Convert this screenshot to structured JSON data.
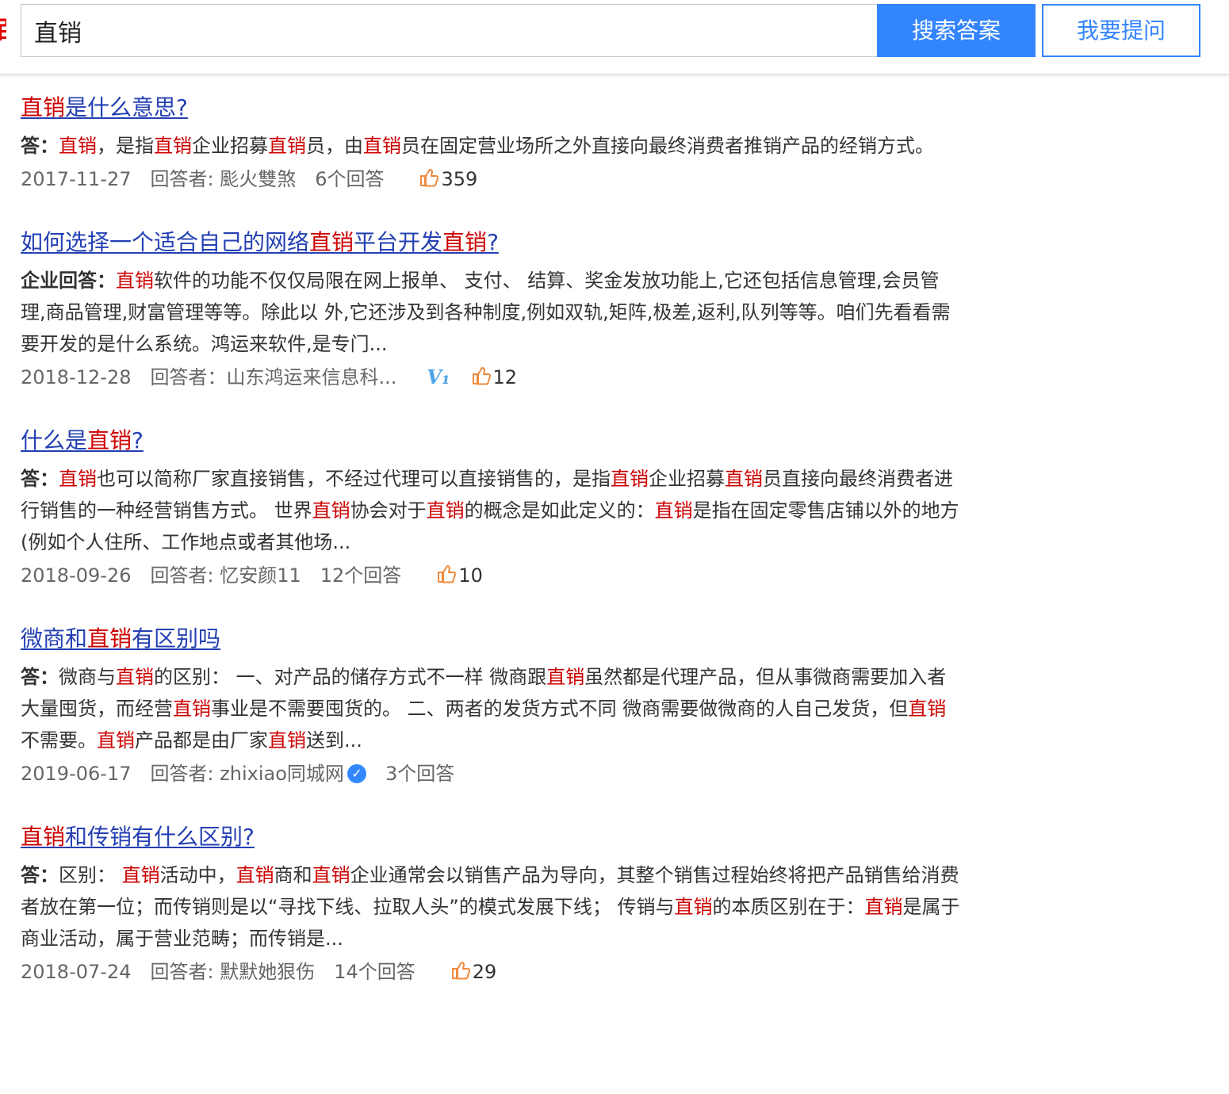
{
  "header": {
    "logo_fragment": "百",
    "search_value": "直销",
    "search_button": "搜索答案",
    "ask_button": "我要提问"
  },
  "results": [
    {
      "title": [
        {
          "t": "直销",
          "h": true
        },
        {
          "t": "是什么意思? ",
          "h": false
        }
      ],
      "prefix": "答：",
      "abstract": [
        {
          "t": "直销",
          "h": true
        },
        {
          "t": "，是指",
          "h": false
        },
        {
          "t": "直销",
          "h": true
        },
        {
          "t": "企业招募",
          "h": false
        },
        {
          "t": "直销",
          "h": true
        },
        {
          "t": "员，由",
          "h": false
        },
        {
          "t": "直销",
          "h": true
        },
        {
          "t": "员在固定营业场所之外直接向最终消费者推销产品的经销方式。",
          "h": false
        }
      ],
      "meta": {
        "date": "2017-11-27",
        "answerer": "回答者: 颩火雙煞",
        "count": "6个回答",
        "likes": "359",
        "badge": ""
      }
    },
    {
      "title": [
        {
          "t": "如何选择一个适合自己的网络",
          "h": false
        },
        {
          "t": "直销",
          "h": true
        },
        {
          "t": "平台开发",
          "h": false
        },
        {
          "t": "直销",
          "h": true
        },
        {
          "t": "?",
          "h": false
        }
      ],
      "prefix": "企业回答：",
      "abstract": [
        {
          "t": "直销",
          "h": true
        },
        {
          "t": "软件的功能不仅仅局限在网上报单、 支付、 结算、奖金发放功能上,它还包括信息管理,会员管理,商品管理,财富管理等等。除此以 外,它还涉及到各种制度,例如双轨,矩阵,极差,返利,队列等等。咱们先看看需要开发的是什么系统。鸿运来软件,是专门...",
          "h": false
        }
      ],
      "meta": {
        "date": "2018-12-28",
        "answerer": "回答者：山东鸿运来信息科...",
        "count": "",
        "likes": "12",
        "badge": "V1"
      }
    },
    {
      "title": [
        {
          "t": "什么是",
          "h": false
        },
        {
          "t": "直销",
          "h": true
        },
        {
          "t": "? ",
          "h": false
        }
      ],
      "prefix": "答：",
      "abstract": [
        {
          "t": "直销",
          "h": true
        },
        {
          "t": "也可以简称厂家直接销售，不经过代理可以直接销售的，是指",
          "h": false
        },
        {
          "t": "直销",
          "h": true
        },
        {
          "t": "企业招募",
          "h": false
        },
        {
          "t": "直销",
          "h": true
        },
        {
          "t": "员直接向最终消费者进行销售的一种经营销售方式。 世界",
          "h": false
        },
        {
          "t": "直销",
          "h": true
        },
        {
          "t": "协会对于",
          "h": false
        },
        {
          "t": "直销",
          "h": true
        },
        {
          "t": "的概念是如此定义的：",
          "h": false
        },
        {
          "t": "直销",
          "h": true
        },
        {
          "t": "是指在固定零售店铺以外的地方(例如个人住所、工作地点或者其他场...",
          "h": false
        }
      ],
      "meta": {
        "date": "2018-09-26",
        "answerer": "回答者: 忆安颜11",
        "count": "12个回答",
        "likes": "10",
        "badge": ""
      }
    },
    {
      "title": [
        {
          "t": "微商和",
          "h": false
        },
        {
          "t": "直销",
          "h": true
        },
        {
          "t": "有区别吗",
          "h": false
        }
      ],
      "prefix": "答：",
      "abstract": [
        {
          "t": "微商与",
          "h": false
        },
        {
          "t": "直销",
          "h": true
        },
        {
          "t": "的区别： 一、对产品的储存方式不一样 微商跟",
          "h": false
        },
        {
          "t": "直销",
          "h": true
        },
        {
          "t": "虽然都是代理产品，但从事微商需要加入者大量囤货，而经营",
          "h": false
        },
        {
          "t": "直销",
          "h": true
        },
        {
          "t": "事业是不需要囤货的。 二、两者的发货方式不同 微商需要做微商的人自己发货，但",
          "h": false
        },
        {
          "t": "直销",
          "h": true
        },
        {
          "t": "不需要。",
          "h": false
        },
        {
          "t": "直销",
          "h": true
        },
        {
          "t": "产品都是由厂家",
          "h": false
        },
        {
          "t": "直销",
          "h": true
        },
        {
          "t": "送到...",
          "h": false
        }
      ],
      "meta": {
        "date": "2019-06-17",
        "answerer": "回答者: zhixiao同城网",
        "count": "3个回答",
        "likes": "",
        "badge": "verified"
      }
    },
    {
      "title": [
        {
          "t": "直销",
          "h": true
        },
        {
          "t": "和传销有什么区别? ",
          "h": false
        }
      ],
      "prefix": "答：",
      "abstract": [
        {
          "t": "区别： ",
          "h": false
        },
        {
          "t": "直销",
          "h": true
        },
        {
          "t": "活动中，",
          "h": false
        },
        {
          "t": "直销",
          "h": true
        },
        {
          "t": "商和",
          "h": false
        },
        {
          "t": "直销",
          "h": true
        },
        {
          "t": "企业通常会以销售产品为导向，其整个销售过程始终将把产品销售给消费者放在第一位；而传销则是以“寻找下线、拉取人头”的模式发展下线； 传销与",
          "h": false
        },
        {
          "t": "直销",
          "h": true
        },
        {
          "t": "的本质区别在于：",
          "h": false
        },
        {
          "t": "直销",
          "h": true
        },
        {
          "t": "是属于商业活动，属于营业范畴；而传销是...",
          "h": false
        }
      ],
      "meta": {
        "date": "2018-07-24",
        "answerer": "回答者: 默默她狠伤",
        "count": "14个回答",
        "likes": "29",
        "badge": ""
      }
    }
  ]
}
